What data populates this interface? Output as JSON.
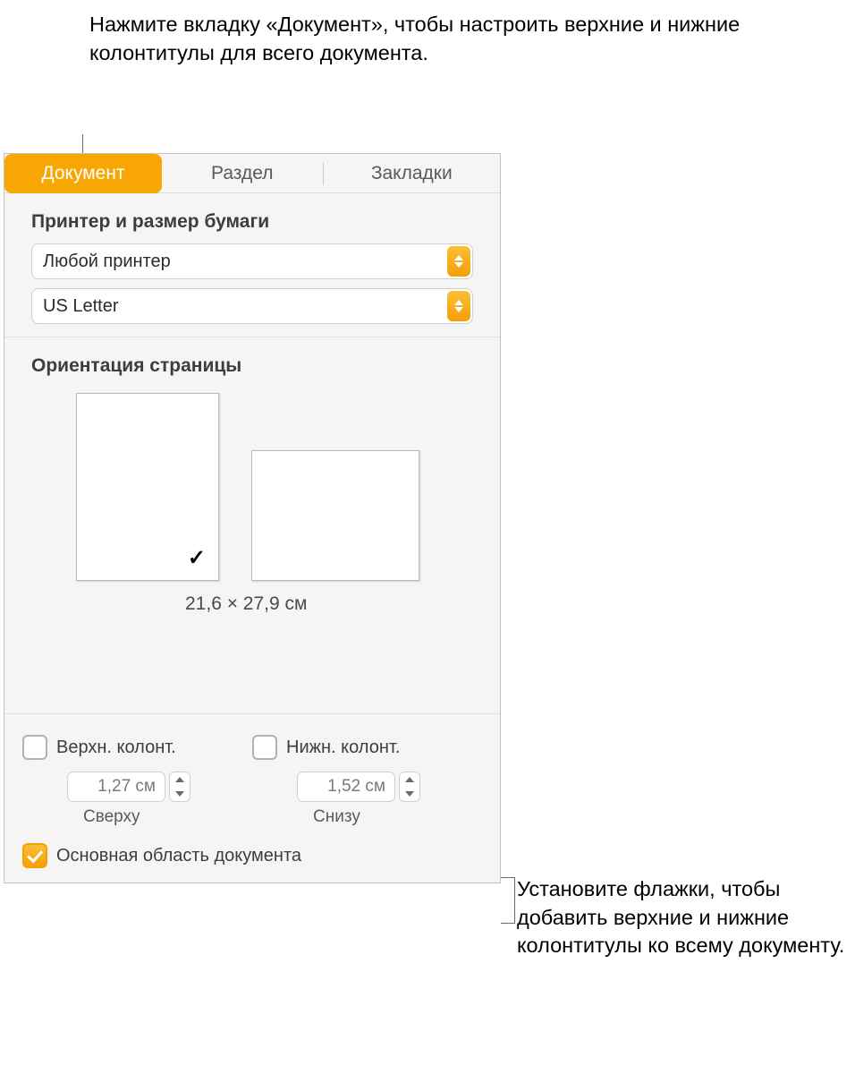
{
  "callouts": {
    "top": "Нажмите вкладку «Документ», чтобы настроить верхние и нижние колонтитулы для всего документа.",
    "right": "Установите флажки, чтобы добавить верхние и нижние колонтитулы ко всему документу."
  },
  "tabs": {
    "document": "Документ",
    "section": "Раздел",
    "bookmarks": "Закладки"
  },
  "printer": {
    "header": "Принтер и размер бумаги",
    "printer_value": "Любой принтер",
    "paper_value": "US Letter"
  },
  "orientation": {
    "header": "Ориентация страницы",
    "size_label": "21,6 × 27,9 см"
  },
  "hf": {
    "header_label": "Верхн. колонт.",
    "footer_label": "Нижн. колонт.",
    "header_val": "1,27 см",
    "footer_val": "1,52 см",
    "top_lbl": "Сверху",
    "bottom_lbl": "Снизу",
    "body_label": "Основная область документа"
  }
}
